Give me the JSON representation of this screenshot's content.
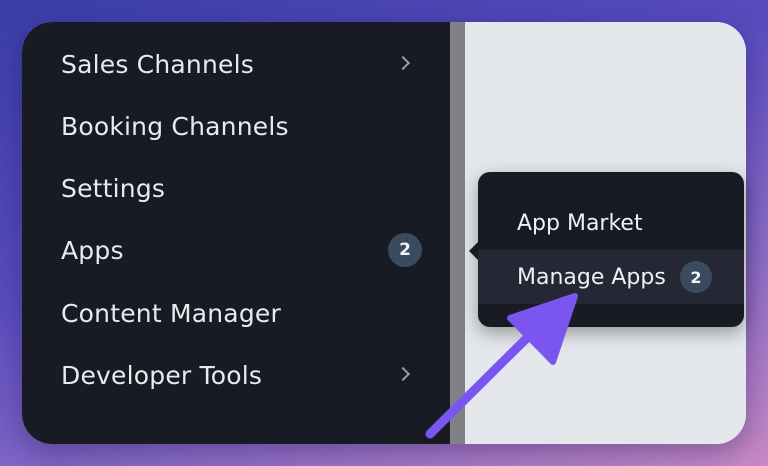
{
  "sidebar": {
    "items": [
      {
        "label": "Sales Channels",
        "has_chevron": true
      },
      {
        "label": "Booking Channels"
      },
      {
        "label": "Settings"
      },
      {
        "label": "Apps",
        "badge": "2"
      },
      {
        "label": "Content Manager"
      },
      {
        "label": "Developer Tools",
        "has_chevron": true
      }
    ]
  },
  "submenu": {
    "items": [
      {
        "label": "App Market"
      },
      {
        "label": "Manage Apps",
        "badge": "2",
        "highlighted": true
      }
    ]
  },
  "annotation": {
    "arrow_color": "#7b55f0",
    "icon": "pointer-arrow"
  },
  "colors": {
    "sidebar_bg": "#181b24",
    "content_bg": "#e4e7ec",
    "badge_bg": "#3b4b5e"
  }
}
